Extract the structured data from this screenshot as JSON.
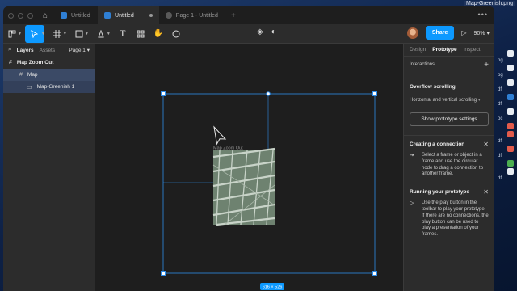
{
  "desktop": {
    "file_label": "Map-Greenish.png",
    "dock_labels": [
      "ng",
      "pg",
      "df",
      "df",
      "oc",
      "df",
      "df",
      "df"
    ]
  },
  "window": {
    "tabs": [
      {
        "label": "Untitled",
        "active": false
      },
      {
        "label": "Untitled",
        "active": true
      },
      {
        "label": "Page 1 - Untitled",
        "active": false
      }
    ],
    "new_tab": "+",
    "more": "•••"
  },
  "toolbar": {
    "share_label": "Share",
    "zoom_label": "90%"
  },
  "layers_panel": {
    "tab_layers": "Layers",
    "tab_assets": "Assets",
    "page_selector": "Page 1",
    "items": [
      {
        "label": "Map Zoom Out",
        "level": 0
      },
      {
        "label": "Map",
        "level": 1
      },
      {
        "label": "Map-Greenish 1",
        "level": 2
      }
    ]
  },
  "canvas": {
    "frame_label": "Map Zoom Out",
    "size_badge": "616 × 526"
  },
  "right_panel": {
    "tabs": [
      "Design",
      "Prototype",
      "Inspect"
    ],
    "active_tab": "Prototype",
    "interactions_label": "Interactions",
    "overflow_title": "Overflow scrolling",
    "overflow_value": "Horizontal and vertical scrolling",
    "settings_button": "Show prototype settings",
    "creating_title": "Creating a connection",
    "creating_body": "Select a frame or object in a frame and use the circular node to drag a connection to another frame.",
    "running_title": "Running your prototype",
    "running_body": "Use the play button in the toolbar to play your prototype. If there are no connections, the play button can be used to play a presentation of your frames."
  },
  "colors": {
    "accent": "#0d99ff",
    "map_fill": "#6e8270",
    "canvas_bg": "#1e1e1e"
  }
}
